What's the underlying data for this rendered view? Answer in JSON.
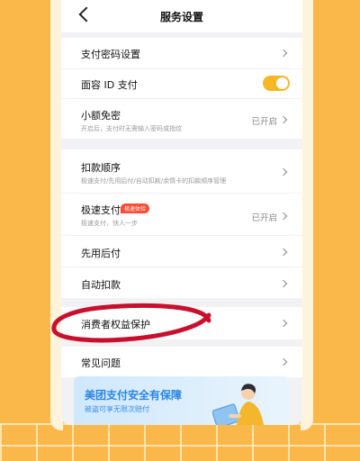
{
  "navbar": {
    "title": "服务设置"
  },
  "rows": [
    {
      "label": "支付密码设置"
    },
    {
      "label": "面容 ID 支付"
    },
    {
      "label": "小额免密",
      "sub": "开启后，支付时无需输入密码或指纹",
      "status": "已开启"
    },
    {
      "label": "扣款顺序",
      "sub": "极速支付/先用后付/自动扣款/余情卡的扣款顺序管理"
    },
    {
      "label": "极速支付",
      "badge": "极速体验",
      "sub": "极速支付，快人一步",
      "status": "已开启"
    },
    {
      "label": "先用后付"
    },
    {
      "label": "自动扣款"
    },
    {
      "label": "消费者权益保护"
    },
    {
      "label": "常见问题"
    }
  ],
  "toggle": {
    "face_id_enabled": true
  },
  "banner": {
    "title": "美团支付安全有保障",
    "subtitle": "被盗可享无限次赔付"
  },
  "colors": {
    "accent": "#f6b726",
    "badge": "#ff4b33",
    "annotation": "#c8102e",
    "banner_text": "#2b85e4"
  }
}
